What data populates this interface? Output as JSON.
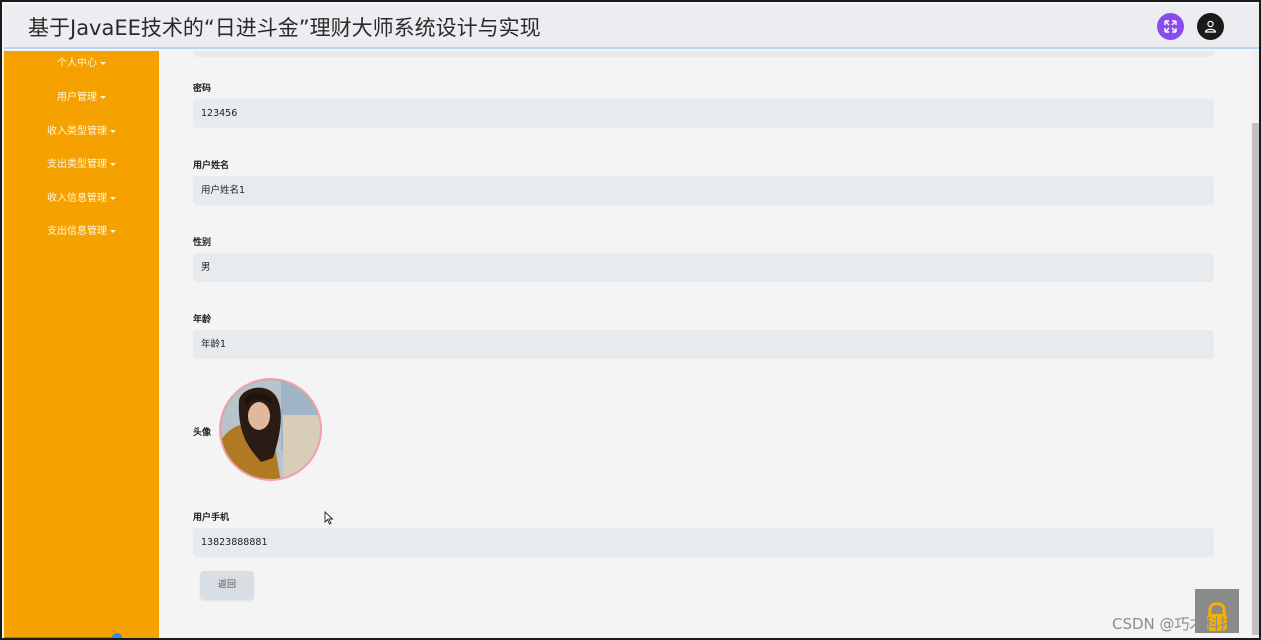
{
  "header": {
    "title": "基于JavaEE技术的“日进斗金”理财大师系统设计与实现",
    "fullscreen_icon": "expand-icon",
    "user_icon": "user-icon",
    "fullscreen_color": "#8a4cf0",
    "user_color": "#1a1a1a"
  },
  "sidebar": {
    "background": "#f5a100",
    "items": [
      {
        "label": "个人中心"
      },
      {
        "label": "用户管理"
      },
      {
        "label": "收入类型管理"
      },
      {
        "label": "支出类型管理"
      },
      {
        "label": "收入信息管理"
      },
      {
        "label": "支出信息管理"
      }
    ]
  },
  "form": {
    "password_label": "密码",
    "password_value": "123456",
    "name_label": "用户姓名",
    "name_value": "用户姓名1",
    "gender_label": "性别",
    "gender_value": "男",
    "age_label": "年龄",
    "age_value": "年龄1",
    "avatar_label": "头像",
    "phone_label": "用户手机",
    "phone_value": "13823888881",
    "back_label": "返回"
  },
  "watermark": "CSDN @巧才科技"
}
